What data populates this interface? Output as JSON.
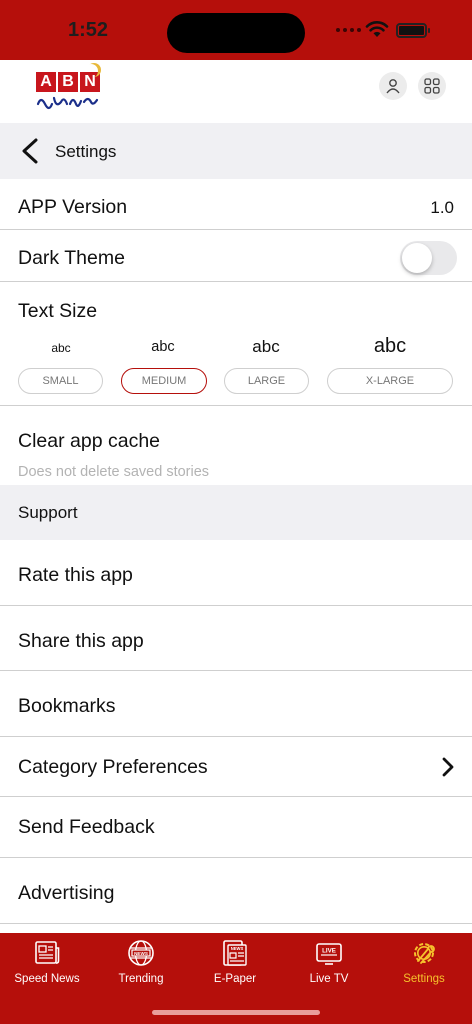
{
  "status": {
    "time": "1:52"
  },
  "brand": {
    "letters": [
      "A",
      "B",
      "N"
    ]
  },
  "nav": {
    "title": "Settings"
  },
  "settings": {
    "app_version_label": "APP Version",
    "app_version_value": "1.0",
    "dark_theme_label": "Dark Theme",
    "dark_theme_on": false,
    "text_size_label": "Text Size",
    "text_size_samples": [
      "abc",
      "abc",
      "abc",
      "abc"
    ],
    "text_size_options": [
      "SMALL",
      "MEDIUM",
      "LARGE",
      "X-LARGE"
    ],
    "text_size_selected": "MEDIUM",
    "clear_cache_label": "Clear app cache",
    "clear_cache_sub": "Does not delete saved stories"
  },
  "support": {
    "header": "Support",
    "items": [
      "Rate this app",
      "Share this app",
      "Bookmarks",
      "Category Preferences",
      "Send Feedback",
      "Advertising"
    ]
  },
  "tabs": [
    {
      "label": "Speed News",
      "icon": "newspaper-icon"
    },
    {
      "label": "Trending",
      "icon": "globe-news-icon"
    },
    {
      "label": "E-Paper",
      "icon": "epaper-icon"
    },
    {
      "label": "Live TV",
      "icon": "live-tv-icon"
    },
    {
      "label": "Settings",
      "icon": "gear-wrench-icon",
      "active": true
    }
  ],
  "colors": {
    "brand_red": "#b50f0b",
    "active_tab": "#f6c22c",
    "toggle_off": "#e9e9eb"
  }
}
